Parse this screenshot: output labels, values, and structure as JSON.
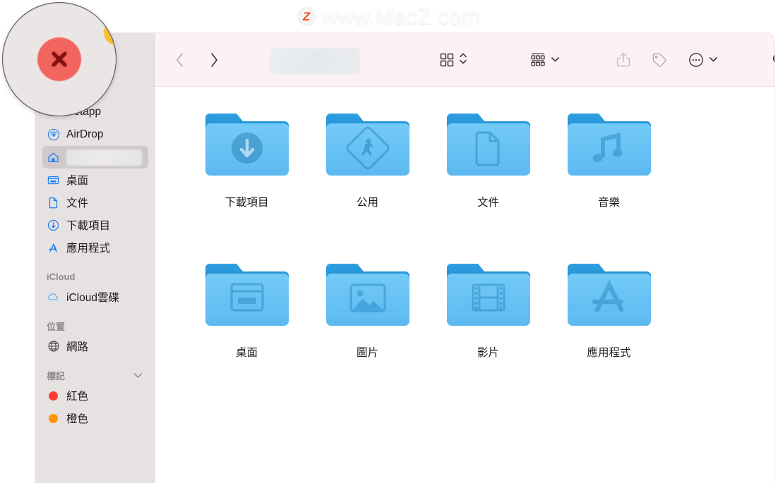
{
  "watermark": {
    "logo_letter": "Z",
    "text": "www.MacZ.com",
    "logo_color": "#f4511e"
  },
  "window": {
    "traffic_lights": {
      "close_color": "#f2655e",
      "minimize_color": "#f6bd2f"
    },
    "toolbar": {
      "back_label": "‹",
      "forward_label": "›",
      "title_value": "",
      "buttons": [
        {
          "name": "view-as-icons",
          "label": ""
        },
        {
          "name": "group-by",
          "label": ""
        },
        {
          "name": "share",
          "label": ""
        },
        {
          "name": "tags",
          "label": ""
        },
        {
          "name": "more-actions",
          "label": ""
        },
        {
          "name": "search",
          "label": ""
        }
      ]
    }
  },
  "sidebar": {
    "favorites": [
      {
        "label": "Setapp",
        "icon": "setapp-icon",
        "selected": false
      },
      {
        "label": "AirDrop",
        "icon": "airdrop-icon",
        "selected": false
      },
      {
        "label": "",
        "icon": "home-icon",
        "selected": true
      },
      {
        "label": "桌面",
        "icon": "desktop-icon",
        "selected": false
      },
      {
        "label": "文件",
        "icon": "documents-icon",
        "selected": false
      },
      {
        "label": "下載項目",
        "icon": "downloads-icon",
        "selected": false
      },
      {
        "label": "應用程式",
        "icon": "applications-icon",
        "selected": false
      }
    ],
    "sections": [
      {
        "title": "iCloud",
        "collapsible": false,
        "items": [
          {
            "label": "iCloud雲碟",
            "icon": "icloud-icon"
          }
        ]
      },
      {
        "title": "位置",
        "collapsible": false,
        "items": [
          {
            "label": "網路",
            "icon": "network-globe-icon"
          }
        ]
      },
      {
        "title": "標記",
        "collapsible": true,
        "items": [
          {
            "label": "紅色",
            "icon": "tag-dot-red",
            "color": "#ff3b30"
          },
          {
            "label": "橙色",
            "icon": "tag-dot-orange",
            "color": "#ff9500"
          }
        ]
      }
    ]
  },
  "content": {
    "items": [
      {
        "label": "下載項目",
        "emblem": "download-arrow-emblem"
      },
      {
        "label": "公用",
        "emblem": "public-walking-sign-emblem"
      },
      {
        "label": "文件",
        "emblem": "document-page-emblem"
      },
      {
        "label": "音樂",
        "emblem": "music-note-emblem"
      },
      {
        "label": "桌面",
        "emblem": "desktop-window-emblem"
      },
      {
        "label": "圖片",
        "emblem": "photo-image-emblem"
      },
      {
        "label": "影片",
        "emblem": "film-strip-emblem"
      },
      {
        "label": "應用程式",
        "emblem": "app-store-a-emblem"
      }
    ]
  }
}
